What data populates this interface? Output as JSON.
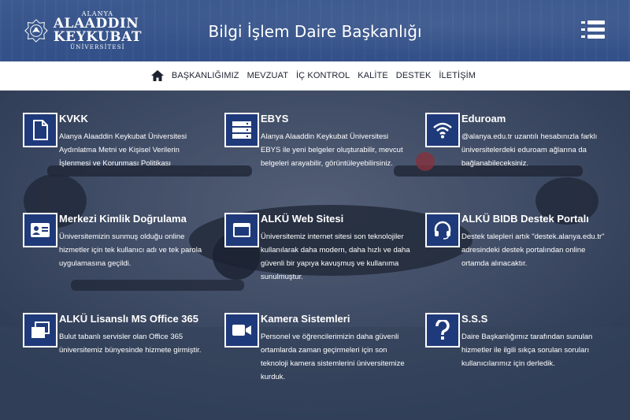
{
  "header": {
    "logo": {
      "line1": "ALANYA",
      "line2": "ALAADDIN",
      "line3": "KEYKUBAT",
      "line4": "ÜNİVERSİTESİ"
    },
    "title": "Bilgi İşlem Daire Başkanlığı"
  },
  "nav": {
    "items": [
      "BAŞKANLIĞIMIZ",
      "MEVZUAT",
      "İÇ KONTROL",
      "KALİTE",
      "DESTEK",
      "İLETİŞİM"
    ]
  },
  "cards": [
    {
      "title": "KVKK",
      "icon": "document-icon",
      "desc": "Alanya Alaaddin Keykubat Üniversitesi Aydınlatma Metni ve Kişisel Verilerin İşlenmesi ve Korunması Politikası"
    },
    {
      "title": "EBYS",
      "icon": "server-icon",
      "desc": "Alanya Alaaddin Keykubat Üniversitesi EBYS ile yeni belgeler oluşturabilir, mevcut belgeleri arayabilir, görüntüleyebilirsiniz."
    },
    {
      "title": "Eduroam",
      "icon": "wifi-icon",
      "desc": "@alanya.edu.tr uzantılı hesabınızla farklı üniversitelerdeki eduroam ağlarına da bağlanabileceksiniz."
    },
    {
      "title": "Merkezi Kimlik Doğrulama",
      "icon": "id-card-icon",
      "desc": "Üniversitemizin sunmuş olduğu online hizmetler için tek kullanıcı adı ve tek parola uygulamasına geçildi."
    },
    {
      "title": "ALKÜ Web Sitesi",
      "icon": "browser-icon",
      "desc": "Üniversitemiz internet sitesi son teknolojiler kullanılarak daha modern, daha hızlı ve daha güvenli bir yapıya kavuşmuş ve kullanıma sunulmuştur."
    },
    {
      "title": "ALKÜ BIDB Destek Portalı",
      "icon": "headset-icon",
      "desc": "Destek talepleri artık \"destek.alanya.edu.tr\" adresindeki destek portalından online ortamda alınacaktır."
    },
    {
      "title": "ALKÜ Lisanslı MS Office 365",
      "icon": "windows-icon",
      "desc": "Bulut tabanlı servisler olan Office 365 üniversitemiz bünyesinde hizmete girmiştir."
    },
    {
      "title": "Kamera Sistemleri",
      "icon": "video-camera-icon",
      "desc": "Personel ve öğrencilerimizin daha güvenli ortamlarda zaman geçirmeleri için son teknoloji kamera sistemlerini üniversitemize kurduk."
    },
    {
      "title": "S.S.S",
      "icon": "question-icon",
      "desc": "Daire Başkanlığımız tarafından sunulan hizmetler ile ilgili sıkça sorulan soruları kullanıcılarımız için derledik."
    }
  ]
}
